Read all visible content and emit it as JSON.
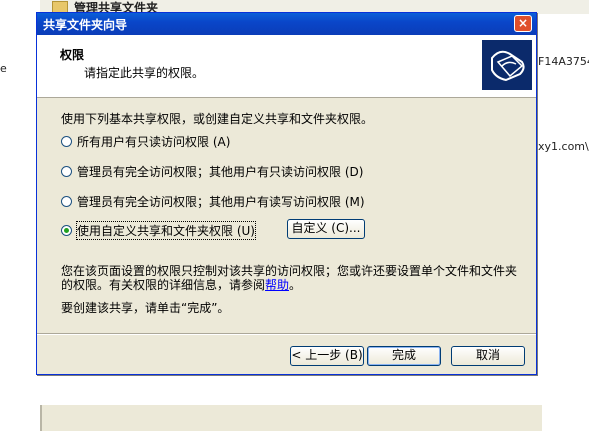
{
  "background_window": {
    "title": "管理共享文件夹",
    "fragment_left": "e",
    "fragment_right_1": "F14A3754",
    "fragment_right_2": "xy1.com\\"
  },
  "dialog": {
    "title": "共享文件夹向导",
    "close_label": "×",
    "header": {
      "title": "权限",
      "subtitle": "请指定此共享的权限。"
    },
    "intro": "使用下列基本共享权限，或创建自定义共享和文件夹权限。",
    "options": [
      {
        "label": "所有用户有只读访问权限 (A)",
        "checked": false
      },
      {
        "label": "管理员有完全访问权限；其他用户有只读访问权限 (D)",
        "checked": false
      },
      {
        "label": "管理员有完全访问权限；其他用户有读写访问权限 (M)",
        "checked": false
      },
      {
        "label": "使用自定义共享和文件夹权限 (U)",
        "checked": true
      }
    ],
    "custom_button": "自定义 (C)...",
    "note_prefix": "您在该页面设置的权限只控制对该共享的访问权限；您或许还要设置单个文件和文件夹的权限。有关权限的详细信息，请参阅",
    "note_link": "帮助",
    "note_suffix": "。",
    "finish_hint": "要创建该共享，请单击“完成”。",
    "buttons": {
      "back": "< 上一步 (B)",
      "finish": "完成",
      "cancel": "取消"
    }
  },
  "colors": {
    "titlebar": "#0a46c9",
    "dialog_bg": "#ece9d8",
    "link": "#0000ff"
  }
}
